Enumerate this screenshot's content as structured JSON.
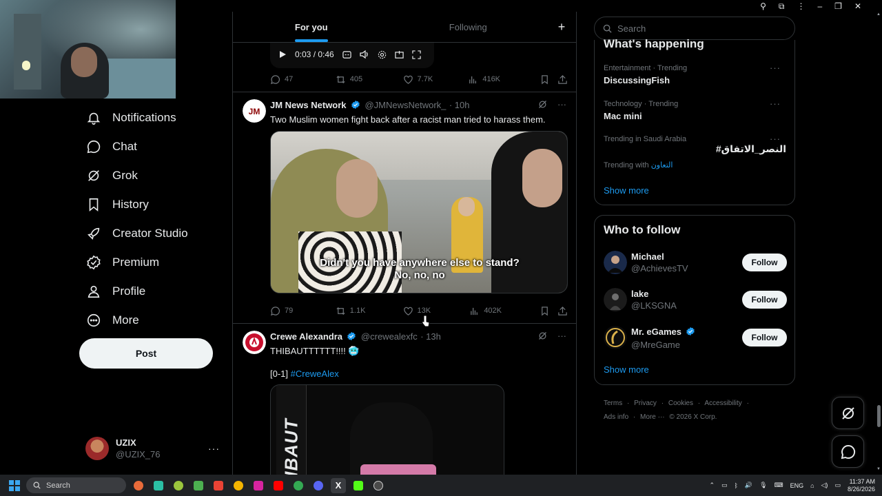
{
  "window": {
    "tabs": {
      "for_you": "For you",
      "following": "Following",
      "plus": "+"
    }
  },
  "left_nav": {
    "items": [
      {
        "label": "Notifications",
        "icon": "bell-icon"
      },
      {
        "label": "Chat",
        "icon": "chat-icon"
      },
      {
        "label": "Grok",
        "icon": "grok-icon"
      },
      {
        "label": "History",
        "icon": "bookmark-icon"
      },
      {
        "label": "Creator Studio",
        "icon": "rocket-icon"
      },
      {
        "label": "Premium",
        "icon": "verified-badge-icon"
      },
      {
        "label": "Profile",
        "icon": "person-icon"
      },
      {
        "label": "More",
        "icon": "more-circle-icon"
      }
    ],
    "post_label": "Post",
    "account": {
      "name": "UZIX",
      "handle": "@UZIX_76",
      "more": "···"
    }
  },
  "feed": {
    "video1": {
      "time": "0:03 / 0:46",
      "counts": {
        "replies": "47",
        "reposts": "405",
        "likes": "7.7K",
        "views": "416K"
      }
    },
    "post2": {
      "name": "JM News Network",
      "handle": "@JMNewsNetwork_",
      "time": "· 10h",
      "text": "Two Muslim women fight back after a racist man tried to harass them.",
      "caption_line1": "Didn't you have anywhere else to stand?",
      "caption_line2": "No, no, no",
      "counts": {
        "replies": "79",
        "reposts": "1.1K",
        "likes": "13K",
        "views": "402K"
      },
      "avatar_text": "JM"
    },
    "post3": {
      "name": "Crewe Alexandra",
      "handle": "@crewealexfc",
      "time": "· 13h",
      "text": "THIBAUTTTTTT!!!! 🥶",
      "score": "[0-1]",
      "hashtag": "#CreweAlex",
      "media_banner": "IBAUT"
    }
  },
  "right": {
    "search_placeholder": "Search",
    "trending_title": "What's happening",
    "trends": [
      {
        "meta": "Entertainment · Trending",
        "topic": "DiscussingFish"
      },
      {
        "meta": "Technology · Trending",
        "topic": "Mac mini"
      },
      {
        "meta": "Trending in Saudi Arabia",
        "topic": "#النصر_الاتفاق",
        "with_label": "Trending with",
        "with_link": "التعاون"
      }
    ],
    "trend_more": "···",
    "show_more": "Show more",
    "who_title": "Who to follow",
    "suggestions": [
      {
        "name": "Michael",
        "handle": "@AchievesTV",
        "follow": "Follow"
      },
      {
        "name": "lake",
        "handle": "@LKSGNA",
        "follow": "Follow"
      },
      {
        "name": "Mr. eGames",
        "handle": "@MreGame",
        "follow": "Follow"
      }
    ],
    "who_show_more": "Show more",
    "footer": [
      "Terms",
      "·",
      "Privacy",
      "·",
      "Cookies",
      "·",
      "Accessibility",
      "·",
      "Ads info",
      "·",
      "More ···",
      "© 2026 X Corp."
    ]
  },
  "taskbar": {
    "search": "Search",
    "lang": "ENG",
    "time": "11:37 AM",
    "date": "8/26/2026"
  },
  "colors": {
    "accent": "#1d9bf0",
    "background": "#000000",
    "border": "#2f3336",
    "muted": "#71767b",
    "text": "#e7e9ea"
  }
}
